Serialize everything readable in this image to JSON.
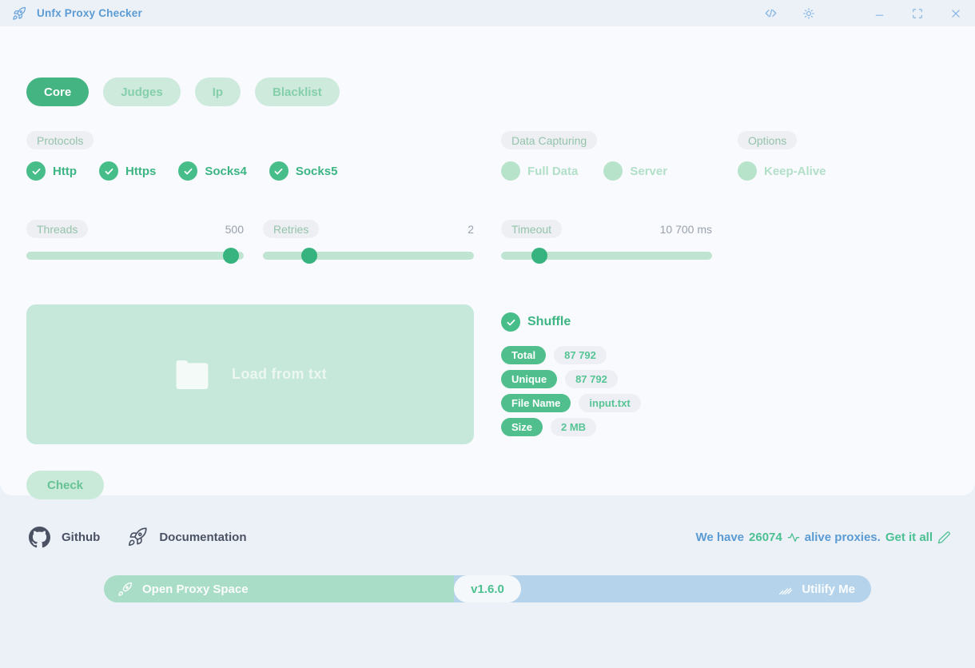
{
  "titlebar": {
    "title": "Unfx Proxy Checker"
  },
  "tabs": [
    {
      "label": "Core",
      "active": true
    },
    {
      "label": "Judges",
      "active": false
    },
    {
      "label": "Ip",
      "active": false
    },
    {
      "label": "Blacklist",
      "active": false
    }
  ],
  "protocols": {
    "label": "Protocols",
    "items": [
      {
        "label": "Http",
        "checked": true
      },
      {
        "label": "Https",
        "checked": true
      },
      {
        "label": "Socks4",
        "checked": true
      },
      {
        "label": "Socks5",
        "checked": true
      }
    ]
  },
  "data_capturing": {
    "label": "Data Capturing",
    "items": [
      {
        "label": "Full Data",
        "checked": false
      },
      {
        "label": "Server",
        "checked": false
      }
    ]
  },
  "options": {
    "label": "Options",
    "items": [
      {
        "label": "Keep-Alive",
        "checked": false
      }
    ]
  },
  "sliders": [
    {
      "label": "Threads",
      "value": "500"
    },
    {
      "label": "Retries",
      "value": "2"
    },
    {
      "label": "Timeout",
      "value": "10 700 ms"
    }
  ],
  "dropzone": {
    "label": "Load from txt"
  },
  "shuffle": {
    "label": "Shuffle",
    "checked": true
  },
  "stats": [
    {
      "key": "Total",
      "value": "87 792"
    },
    {
      "key": "Unique",
      "value": "87 792"
    },
    {
      "key": "File Name",
      "value": "input.txt"
    },
    {
      "key": "Size",
      "value": "2 MB"
    }
  ],
  "actions": {
    "check": "Check"
  },
  "footer": {
    "github": "Github",
    "documentation": "Documentation",
    "alive_prefix": "We have",
    "alive_count": "26074",
    "alive_suffix": "alive proxies.",
    "alive_cta": "Get it all",
    "bar": {
      "brand": "Open Proxy Space",
      "version": "v1.6.0",
      "partner": "Utilify Me"
    }
  },
  "colors": {
    "accent_green": "#45b483",
    "light_green_pill": "#cdeadd",
    "mint_dropzone": "#c6e8da",
    "blue_text": "#5b9bd3",
    "bar_green": "#aaddc8",
    "bar_blue": "#b5d4eb",
    "dark_link": "#4a5264"
  }
}
